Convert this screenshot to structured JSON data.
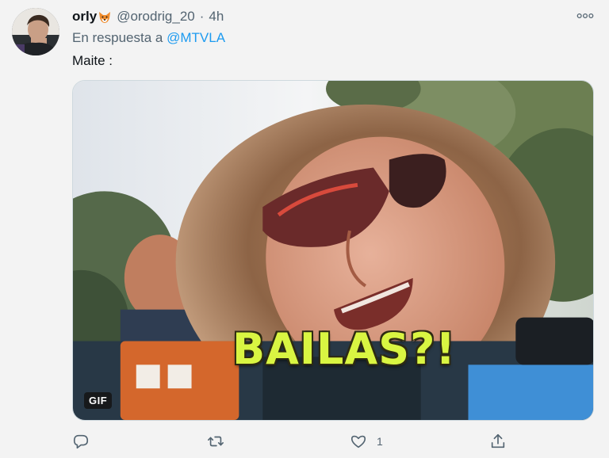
{
  "tweet": {
    "author_name": "orly",
    "author_emoji_icon": "fox-face-icon",
    "handle": "@orodrig_20",
    "separator": "·",
    "time": "4h",
    "reply_prefix": "En respuesta a",
    "reply_to": "@MTVLA",
    "text": "Maite :"
  },
  "media": {
    "type": "gif",
    "caption": "BAILAS?!",
    "badge": "GIF"
  },
  "actions": {
    "reply_icon": "reply-bubble-icon",
    "retweet_icon": "retweet-icon",
    "like_icon": "heart-icon",
    "like_count": "1",
    "share_icon": "share-icon"
  },
  "colors": {
    "accent": "#1d9bf0",
    "secondary_text": "#536471",
    "caption_yellow": "#d9f542"
  }
}
